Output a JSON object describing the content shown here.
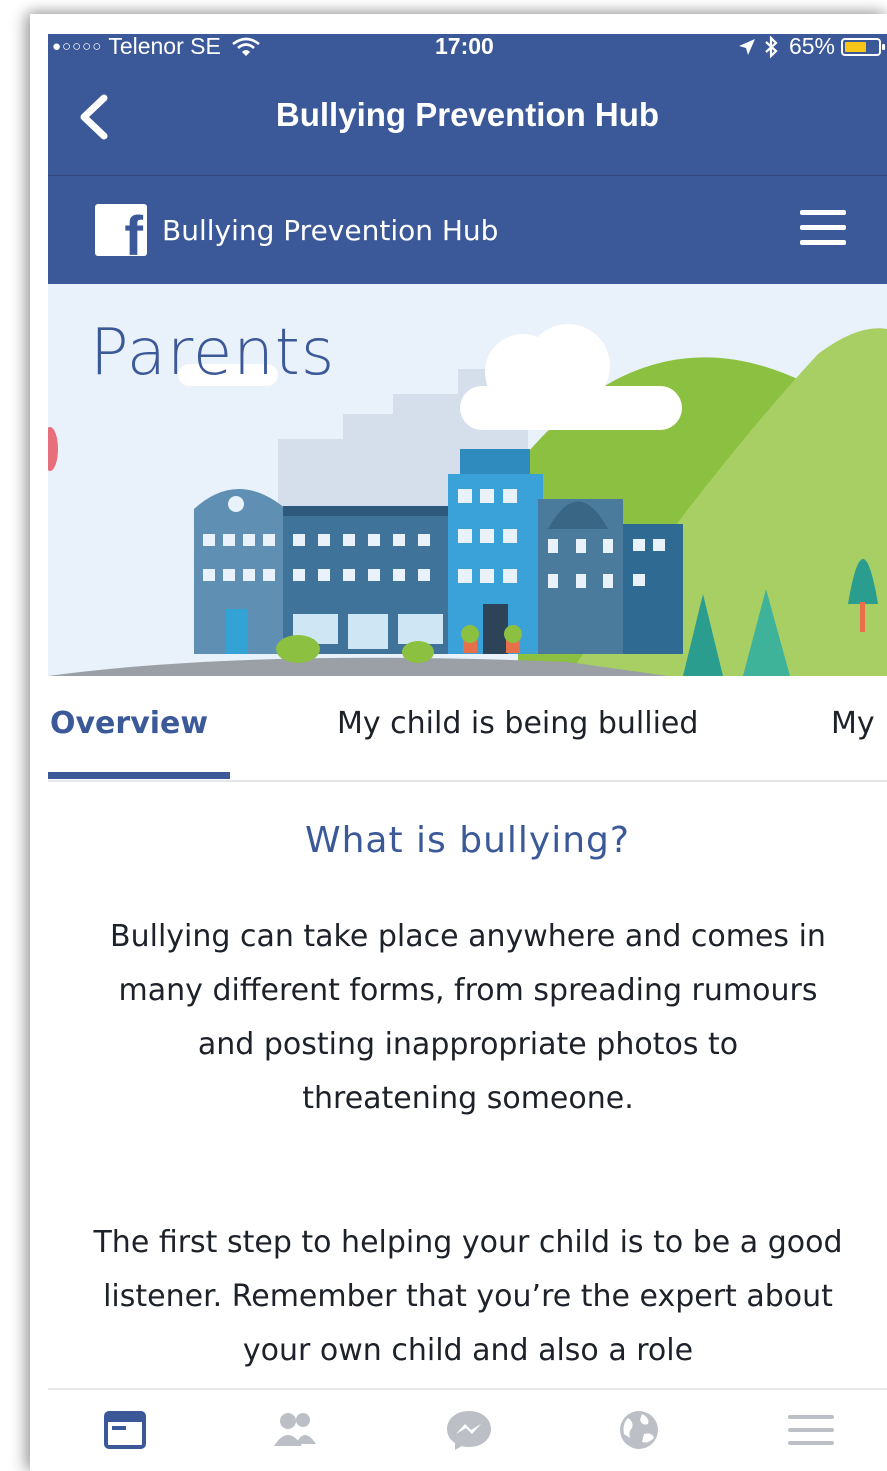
{
  "status_bar": {
    "signal": "●○○○○",
    "carrier": "Telenor SE",
    "time": "17:00",
    "battery_percent": "65%",
    "battery_level": 0.65
  },
  "nav": {
    "title": "Bullying Prevention Hub"
  },
  "hub_header": {
    "logo_letter": "f",
    "title": "Bullying Prevention Hub"
  },
  "hero": {
    "title": "Parents"
  },
  "tabs": [
    {
      "label": "Overview",
      "active": true
    },
    {
      "label": "My child is being bullied",
      "active": false
    },
    {
      "label": "My",
      "active": false
    }
  ],
  "content": {
    "heading": "What is bullying?",
    "paragraph1": "Bullying can take place anywhere and comes in many different forms, from spreading rumours and posting inappropriate photos to threatening someone.",
    "paragraph2": "The first step to helping your child is to be a good listener. Remember that you’re the expert about your own child and also a role"
  },
  "tab_bar": {
    "items": [
      {
        "icon": "news-feed-icon",
        "active": true
      },
      {
        "icon": "friends-icon",
        "active": false
      },
      {
        "icon": "messenger-icon",
        "active": false
      },
      {
        "icon": "globe-icon",
        "active": false
      },
      {
        "icon": "menu-icon",
        "active": false
      }
    ]
  },
  "colors": {
    "brand": "#3b5998",
    "hero_bg": "#e9f1fa",
    "text": "#1d2129",
    "inactive_icon": "#bcc0c6",
    "battery": "#f5c518"
  }
}
